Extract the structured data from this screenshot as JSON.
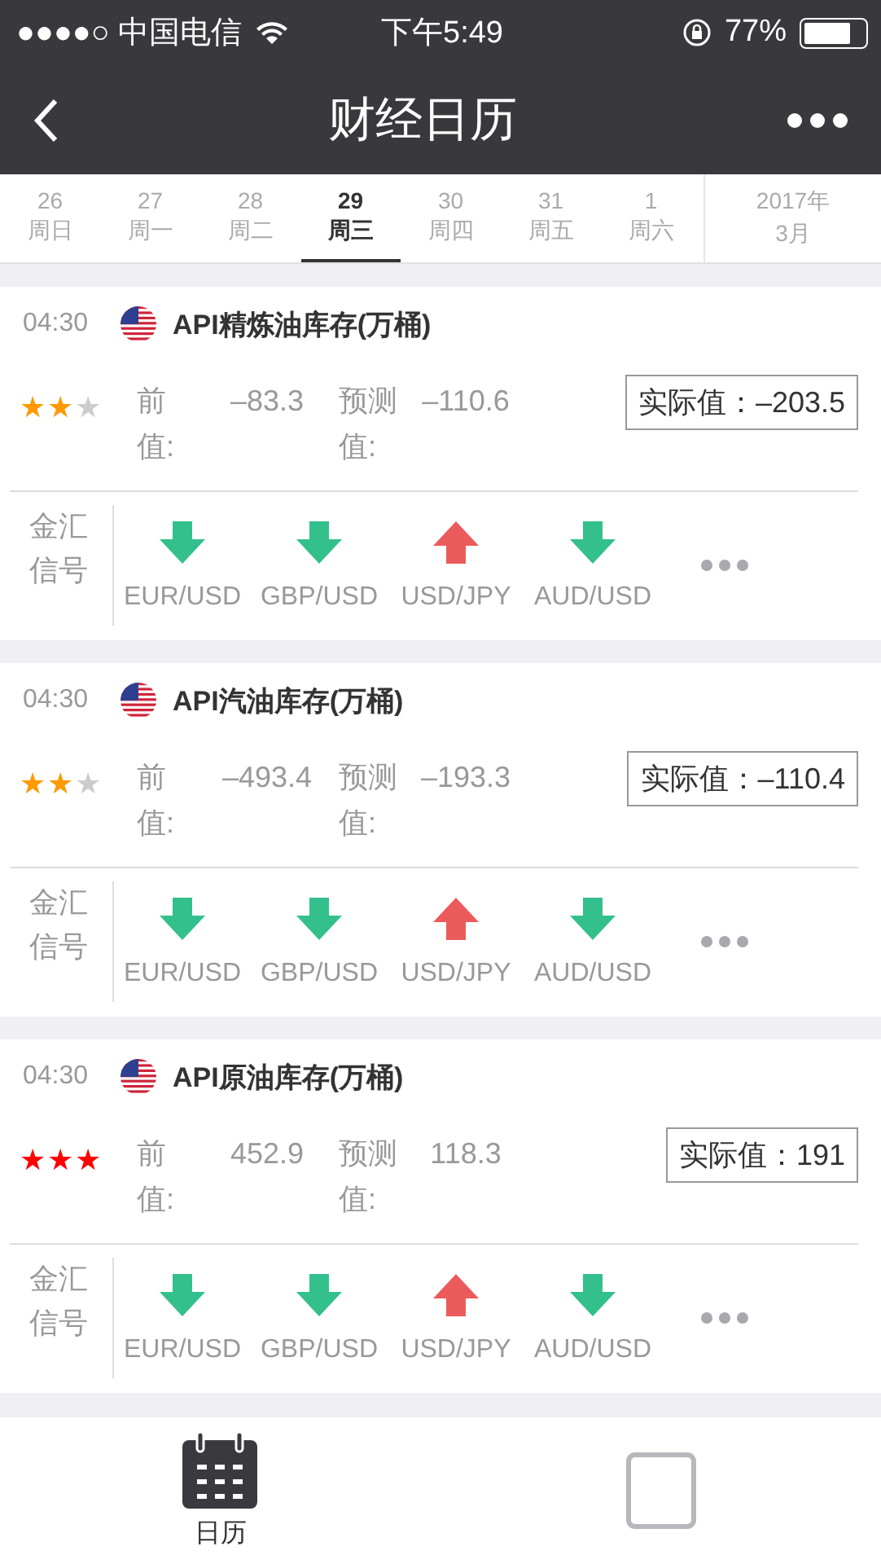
{
  "status_bar": {
    "carrier": "●●●●○ 中国电信",
    "time": "下午5:49",
    "battery": "77%"
  },
  "nav": {
    "title": "财经日历"
  },
  "dates": [
    {
      "day": "26",
      "weekday": "周日",
      "selected": false
    },
    {
      "day": "27",
      "weekday": "周一",
      "selected": false
    },
    {
      "day": "28",
      "weekday": "周二",
      "selected": false
    },
    {
      "day": "29",
      "weekday": "周三",
      "selected": true
    },
    {
      "day": "30",
      "weekday": "周四",
      "selected": false
    },
    {
      "day": "31",
      "weekday": "周五",
      "selected": false
    },
    {
      "day": "1",
      "weekday": "周六",
      "selected": false
    }
  ],
  "month_picker": {
    "year": "2017年",
    "month": "3月"
  },
  "events": [
    {
      "time": "04:30",
      "title": "API精炼油库存(万桶)",
      "stars": 2,
      "color": "#ff9900",
      "previous_label": "前值:",
      "previous": "–83.3",
      "forecast_label": "预测值:",
      "forecast": "–110.6",
      "actual": "实际值：–203.5",
      "signal_label": "金汇信号",
      "signals": [
        {
          "pair": "EUR/USD",
          "kind": "down"
        },
        {
          "pair": "GBP/USD",
          "kind": "down"
        },
        {
          "pair": "USD/JPY",
          "kind": "up"
        },
        {
          "pair": "AUD/USD",
          "kind": "down"
        }
      ]
    },
    {
      "time": "04:30",
      "title": "API汽油库存(万桶)",
      "stars": 2,
      "color": "#ff9900",
      "previous_label": "前值:",
      "previous": "–493.4",
      "forecast_label": "预测值:",
      "forecast": "–193.3",
      "actual": "实际值：–110.4",
      "signal_label": "金汇信号",
      "signals": [
        {
          "pair": "EUR/USD",
          "kind": "down"
        },
        {
          "pair": "GBP/USD",
          "kind": "down"
        },
        {
          "pair": "USD/JPY",
          "kind": "up"
        },
        {
          "pair": "AUD/USD",
          "kind": "down"
        }
      ]
    },
    {
      "time": "04:30",
      "title": "API原油库存(万桶)",
      "stars": 3,
      "color": "#ff0000",
      "previous_label": "前值:",
      "previous": "452.9",
      "forecast_label": "预测值:",
      "forecast": "118.3",
      "actual": "实际值：191",
      "signal_label": "金汇信号",
      "signals": [
        {
          "pair": "EUR/USD",
          "kind": "down"
        },
        {
          "pair": "GBP/USD",
          "kind": "down"
        },
        {
          "pair": "USD/JPY",
          "kind": "up"
        },
        {
          "pair": "AUD/USD",
          "kind": "down"
        }
      ]
    }
  ],
  "tab_bar": [
    {
      "label": "日历",
      "selected": true
    },
    {
      "selected": false
    }
  ]
}
